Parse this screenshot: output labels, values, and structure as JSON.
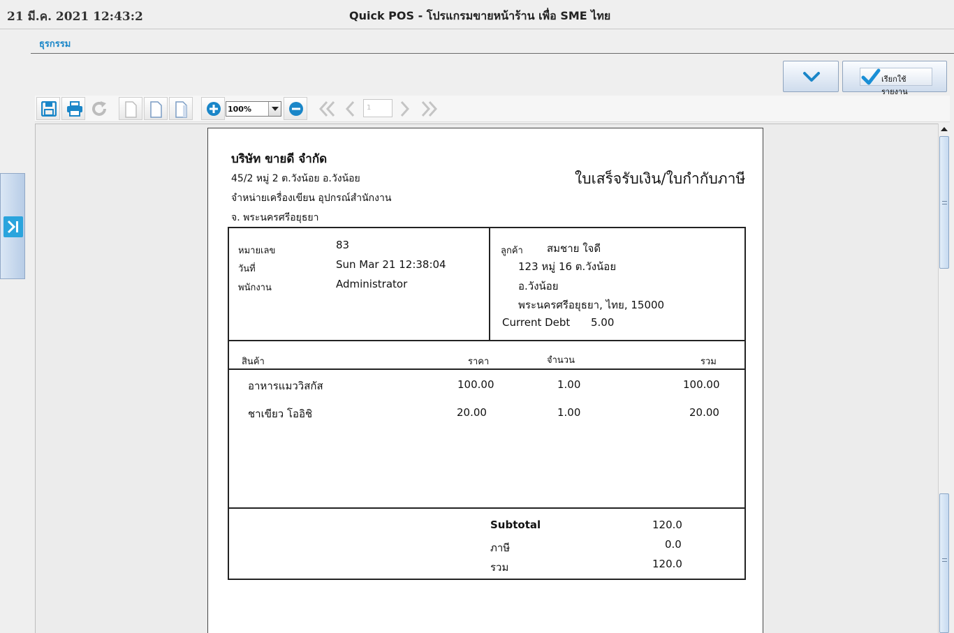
{
  "window": {
    "clock": "21 มี.ค. 2021 12:43:2",
    "title": "Quick POS - โปรแกรมขายหน้าร้าน เพื่อ SME ไทย"
  },
  "menu": {
    "transactions": "ธุรกรรม"
  },
  "actions": {
    "report_label": "เรียกใช้รายงาน"
  },
  "toolbar": {
    "zoom": "100%",
    "page": "1"
  },
  "receipt": {
    "company_name": "บริษัท ขายดี จำกัด",
    "address_lines": [
      "45/2 หมู่ 2 ต.วังน้อย อ.วังน้อย",
      "จำหน่ายเครื่องเขียน อุปกรณ์สำนักงาน",
      "จ. พระนครศรีอยุธยา"
    ],
    "doc_title": "ใบเสร็จรับเงิน/ใบกำกับภาษี",
    "info": {
      "number_label": "หมายเลข",
      "number": "83",
      "date_label": "วันที่",
      "date": "Sun Mar 21 12:38:04",
      "staff_label": "พนักงาน",
      "staff": "Administrator"
    },
    "customer": {
      "label": "ลูกค้า",
      "name": "สมชาย ใจดี",
      "lines": [
        "123 หมู่ 16 ต.วังน้อย",
        "อ.วังน้อย",
        "พระนครศรีอยุธยา, ไทย, 15000"
      ],
      "debt_label": "Current Debt",
      "debt": "5.00"
    },
    "columns": {
      "product": "สินค้า",
      "price": "ราคา",
      "qty": "จำนวน",
      "total": "รวม"
    },
    "items": [
      {
        "name": "อาหารแมววิสกัส",
        "price": "100.00",
        "qty": "1.00",
        "total": "100.00"
      },
      {
        "name": "ชาเขียว โออิชิ",
        "price": "20.00",
        "qty": "1.00",
        "total": "20.00"
      }
    ],
    "summary": {
      "subtotal_label": "Subtotal",
      "subtotal": "120.0",
      "tax_label": "ภาษี",
      "tax": "0.0",
      "total_label": "รวม",
      "total": "120.0"
    }
  },
  "colors": {
    "accent": "#1a86c8",
    "button_top": "#fafcff",
    "button_bottom": "#cfdced",
    "check": "#1a8fd6"
  }
}
